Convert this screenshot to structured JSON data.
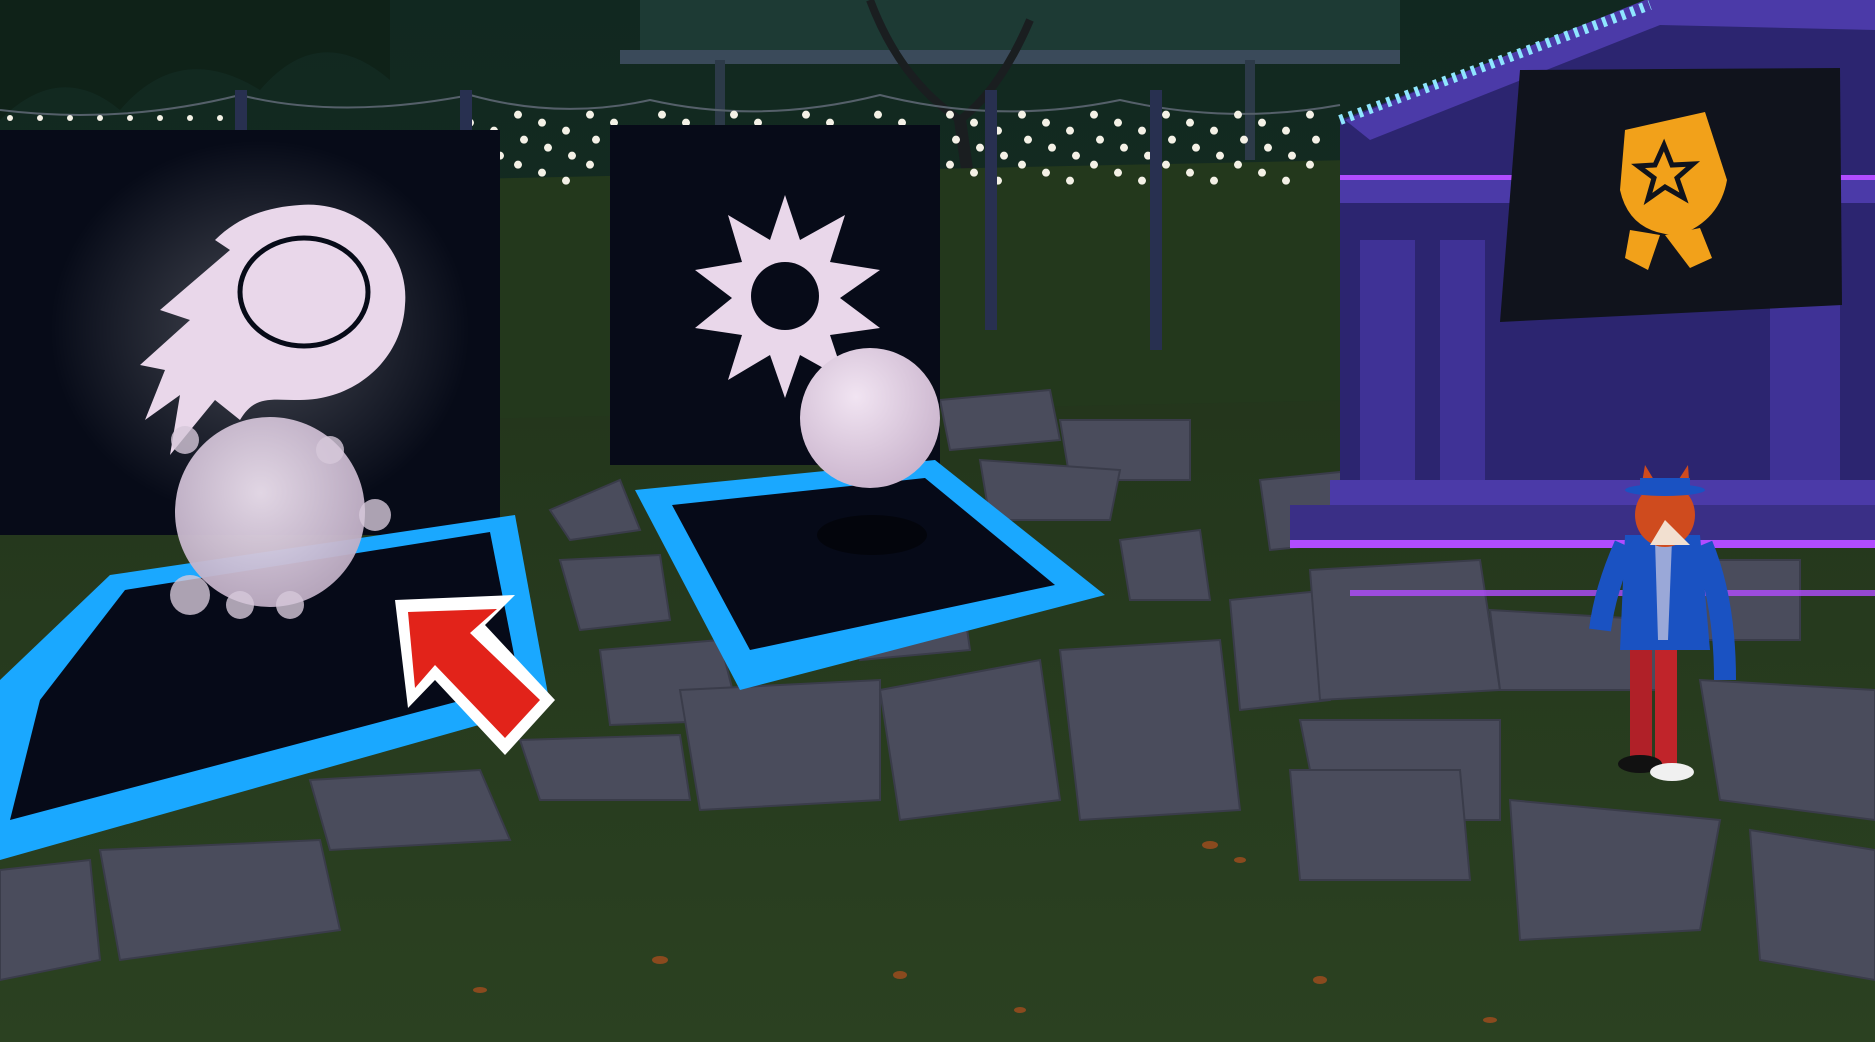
{
  "scene": {
    "name": "night-garden-ability-pads",
    "colors": {
      "sky": "#142a22",
      "grass": "#253a1c",
      "stone": "#4a4c5c",
      "pad_glow": "#1aa8ff",
      "pad_fill": "#060a18",
      "panel": "#070b18",
      "icon": "#e9d7ea",
      "orb": "#d9c7dc",
      "arrow": "#e2231a",
      "building": "#4b3aa8",
      "neon": "#b14cff",
      "badge": "#f2a11a"
    }
  },
  "pads": [
    {
      "id": "pad-1",
      "icon": "meteor-icon",
      "state": "selected"
    },
    {
      "id": "pad-2",
      "icon": "burst-icon",
      "state": "idle"
    }
  ],
  "badge": {
    "icon": "award-ribbon-icon"
  },
  "pointer": {
    "icon": "red-arrow-icon"
  },
  "npc": {
    "icon": "fox-character"
  }
}
